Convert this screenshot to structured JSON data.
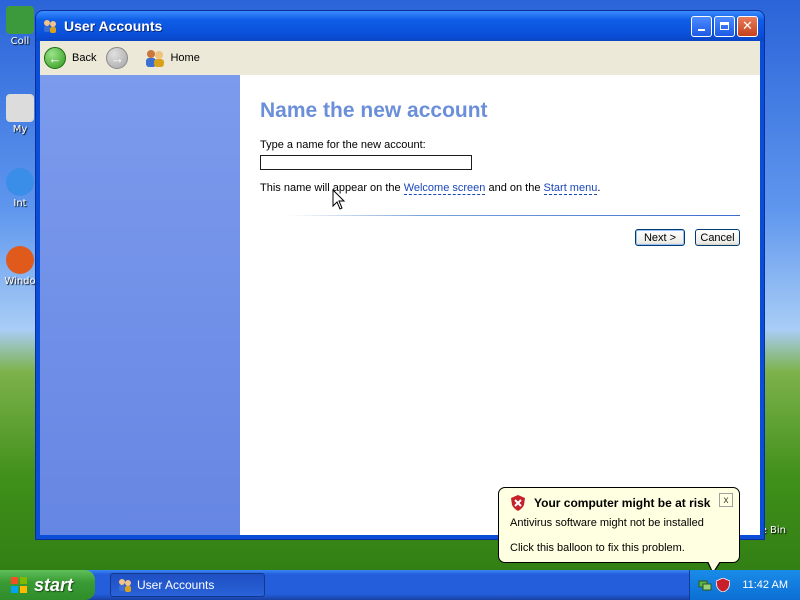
{
  "desktop": {
    "icons": [
      {
        "label": "Coll",
        "icon": "collection-icon"
      },
      {
        "label": "My",
        "icon": "shortcut-icon"
      },
      {
        "label": "Int",
        "icon": "internet-explorer-icon"
      },
      {
        "label": "Windo",
        "icon": "media-player-icon"
      }
    ],
    "recycle_bin_label": "e Bin"
  },
  "window": {
    "title": "User Accounts",
    "controls": [
      "minimize",
      "maximize",
      "close"
    ],
    "toolbar": {
      "back_label": "Back",
      "forward_label": "",
      "home_label": "Home"
    },
    "main": {
      "heading": "Name the new account",
      "prompt": "Type a name for the new account:",
      "name_value": "",
      "info_prefix": "This name will appear on the ",
      "welcome_link": "Welcome screen",
      "info_middle": " and on the ",
      "start_menu_link": "Start menu",
      "info_suffix": ".",
      "next_label": "Next >",
      "cancel_label": "Cancel"
    }
  },
  "balloon": {
    "title": "Your computer might be at risk",
    "line1": "Antivirus software might not be installed",
    "line2": "Click this balloon to fix this problem.",
    "close_glyph": "x"
  },
  "taskbar": {
    "start_label": "start",
    "task_label": "User Accounts",
    "clock": "11:42 AM"
  },
  "colors": {
    "heading": "#6b8fd9",
    "left_pane": "#7c9bed",
    "titlebar": "#0a4ed8",
    "balloon_bg": "#ffffe1"
  }
}
